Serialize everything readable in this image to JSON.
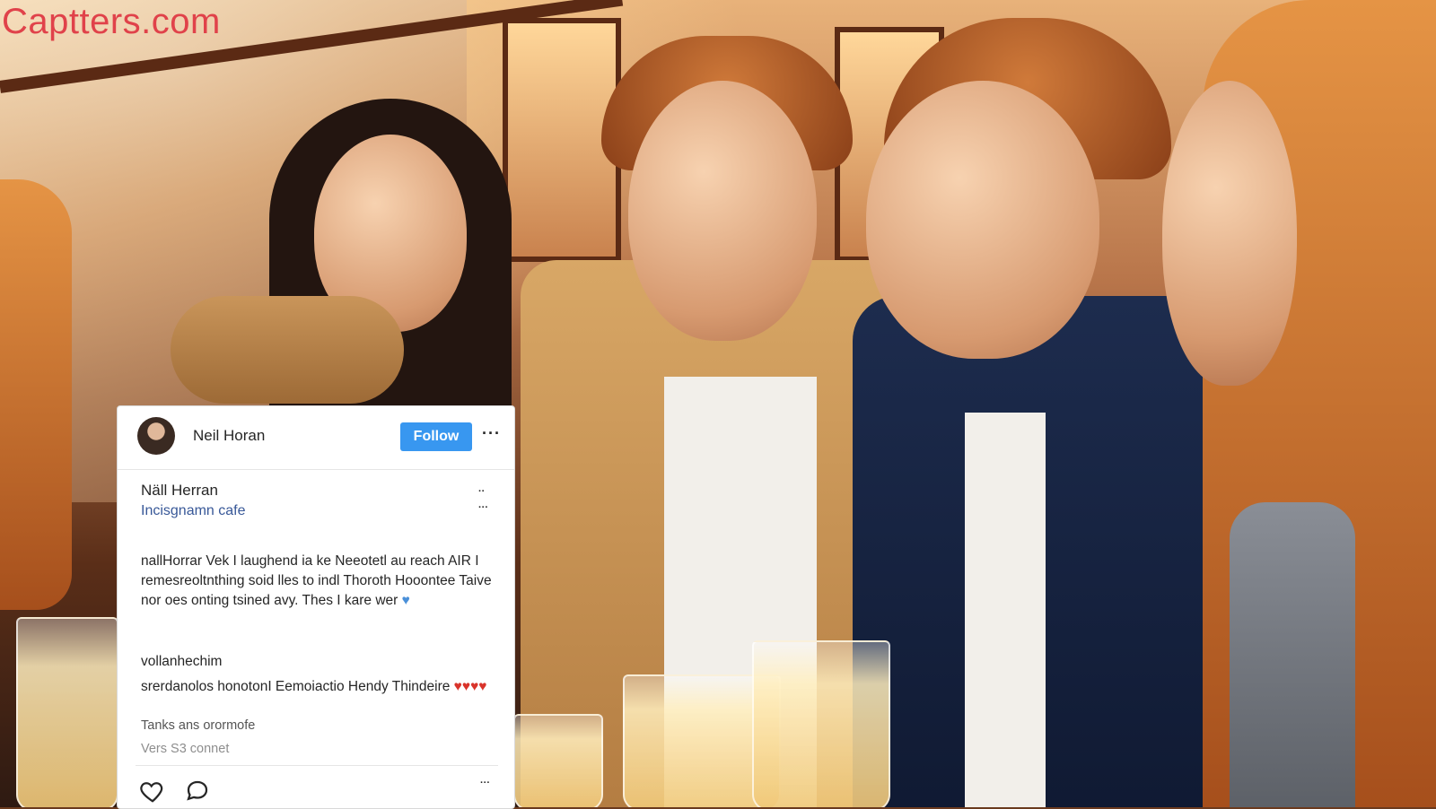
{
  "watermark": "Captters.com",
  "post": {
    "author": "Neil Horan",
    "follow_label": "Follow",
    "caption_user": "Näll Herran",
    "location": "Incisgnamn cafe",
    "caption_text": "nallHorrar Vek I laughend ia ke Neeotetl au reach AIR I remesreoltnthing soid lles to indl Thoroth Hooontee Taive nor oes onting tsined avy. Thes I kare wer",
    "hashtag_line": "vollanhechim",
    "comment_line": "srerdanolos honotonI Eemoiactio Hendy Thindeire",
    "likes_line": "Tanks ans orormofe",
    "view_comments": "Vers S3 connet"
  },
  "icons": {
    "like": "heart-outline-icon",
    "comment": "speech-bubble-icon",
    "more": "more-dots-icon"
  },
  "colors": {
    "watermark": "#e0424a",
    "follow_button": "#3897f0",
    "location_link": "#385898"
  }
}
